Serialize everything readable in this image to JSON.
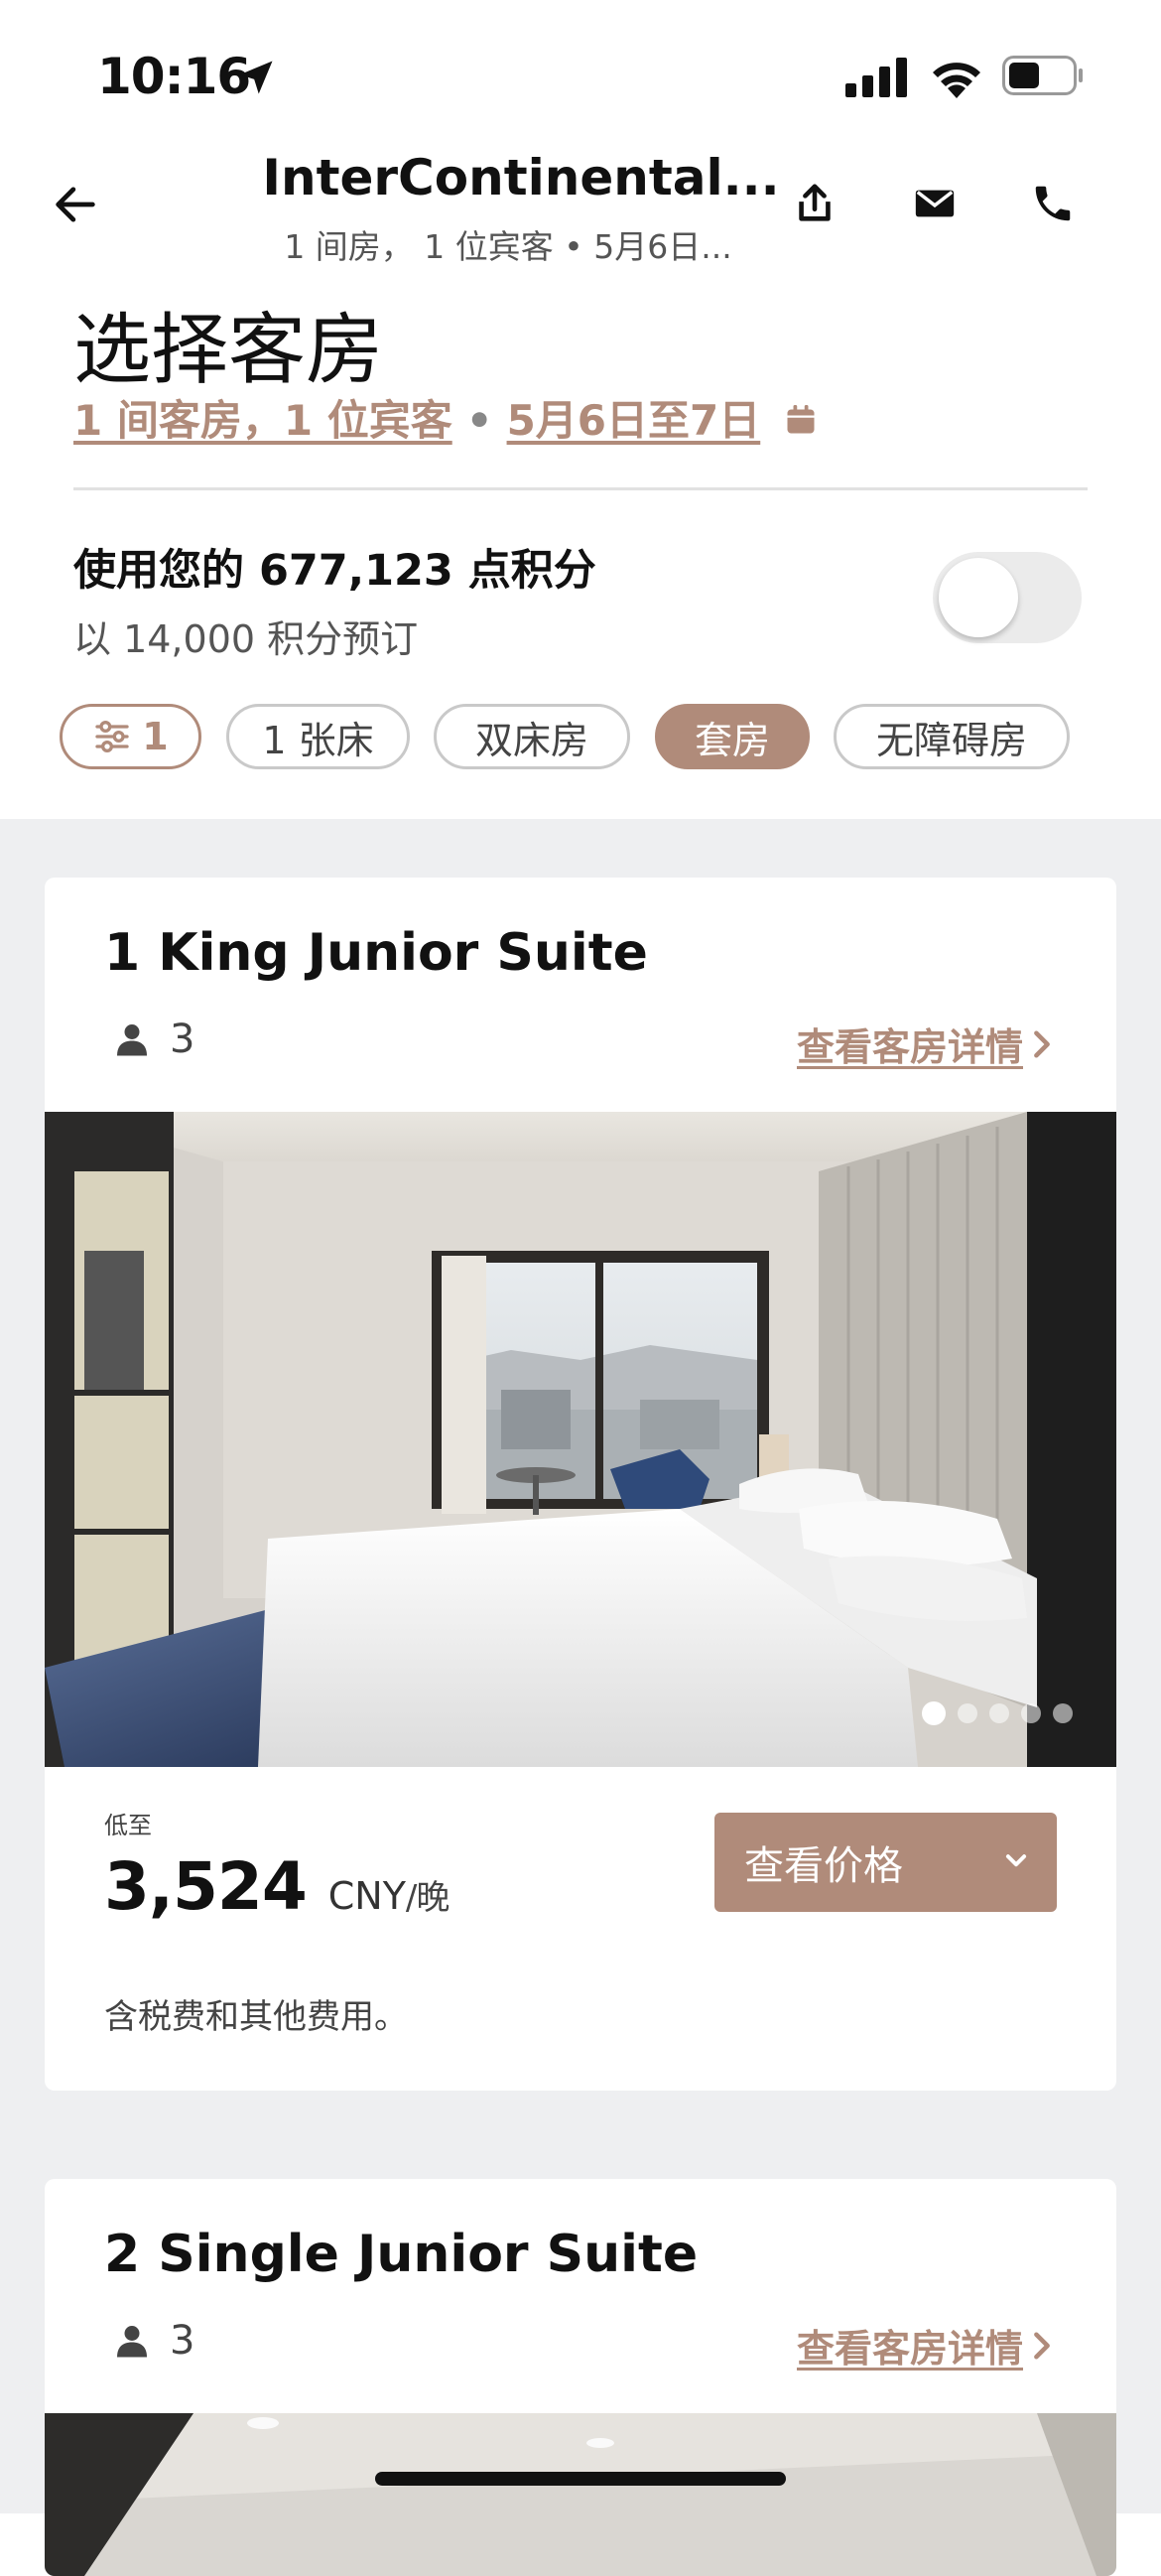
{
  "status_bar": {
    "time": "10:16"
  },
  "nav": {
    "hotel_title": "InterContinental...",
    "hotel_subtitle": "1 间房， 1 位宾客 • 5月6日..."
  },
  "page": {
    "title": "选择客房",
    "rooms_guests_link": "1 间客房，1 位宾客",
    "separator": "•",
    "dates_link": "5月6日至7日"
  },
  "points": {
    "title": "使用您的 677,123 点积分",
    "subtitle": "以 14,000 积分预订",
    "toggle_on": false
  },
  "filters": {
    "filter_count": "1",
    "chips": [
      "1 张床",
      "双床房",
      "套房",
      "无障碍房"
    ],
    "active_chip": "套房"
  },
  "rooms": [
    {
      "name": "1 King Junior Suite",
      "guests": "3",
      "details_link": "查看客房详情",
      "low_from": "低至",
      "price": "3,524",
      "currency": "CNY",
      "per_night": "/晚",
      "view_price_button": "查看价格",
      "tax_note": "含税费和其他费用。",
      "photo_count": 5,
      "photo_active": 1
    },
    {
      "name": "2 Single Junior Suite",
      "guests": "3",
      "details_link": "查看客房详情"
    }
  ],
  "colors": {
    "accent": "#b08b7a",
    "background_gray": "#eeeff1"
  }
}
